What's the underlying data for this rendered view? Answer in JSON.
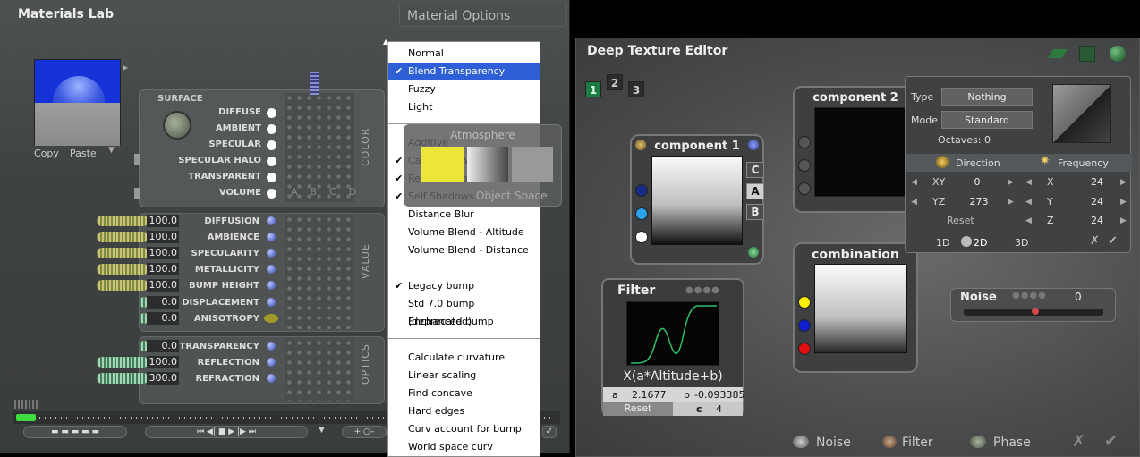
{
  "materials_lab": {
    "title": "Materials Lab",
    "material_options_label": "Material Options",
    "copy_label": "Copy",
    "paste_label": "Paste",
    "surface": {
      "label": "SURFACE",
      "side_label": "COLOR",
      "rows": [
        "DIFFUSE",
        "AMBIENT",
        "SPECULAR",
        "SPECULAR HALO",
        "TRANSPARENT",
        "VOLUME"
      ],
      "abcd": [
        "A",
        "B",
        "C",
        "D"
      ]
    },
    "value": {
      "side_label": "VALUE",
      "rows": [
        {
          "label": "DIFFUSION",
          "value": "100.0"
        },
        {
          "label": "AMBIENCE",
          "value": "100.0"
        },
        {
          "label": "SPECULARITY",
          "value": "100.0"
        },
        {
          "label": "METALLICITY",
          "value": "100.0"
        },
        {
          "label": "BUMP HEIGHT",
          "value": "100.0"
        },
        {
          "label": "DISPLACEMENT",
          "value": "0.0"
        },
        {
          "label": "ANISOTROPY",
          "value": "0.0"
        }
      ]
    },
    "optics": {
      "side_label": "OPTICS",
      "rows": [
        {
          "label": "TRANSPARENCY",
          "value": "0.0"
        },
        {
          "label": "REFLECTION",
          "value": "100.0"
        },
        {
          "label": "REFRACTION",
          "value": "300.0"
        }
      ]
    }
  },
  "menu": {
    "group1": [
      {
        "label": "Normal",
        "checked": false,
        "selected": false
      },
      {
        "label": "Blend Transparency",
        "checked": true,
        "selected": true
      },
      {
        "label": "Fuzzy",
        "checked": false,
        "selected": false
      },
      {
        "label": "Light",
        "checked": false,
        "selected": false
      }
    ],
    "group2": [
      {
        "label": "Additive",
        "checked": false
      },
      {
        "label": "Cast Shadows",
        "checked": true
      },
      {
        "label": "Receive Shadows",
        "checked": true
      },
      {
        "label": "Self Shadows",
        "checked": true
      },
      {
        "label": "Distance Blur",
        "checked": false
      },
      {
        "label": "Volume Blend - Altitude",
        "checked": false
      },
      {
        "label": "Volume Blend - Distance",
        "checked": false
      }
    ],
    "group3": [
      {
        "label": "Legacy bump",
        "checked": true
      },
      {
        "label": "Std 7.0 bump (deprecated)",
        "checked": false
      },
      {
        "label": "Enchanced bump",
        "checked": false
      }
    ],
    "group4": [
      {
        "label": "Calculate curvature",
        "checked": false
      },
      {
        "label": "Linear scaling",
        "checked": false
      },
      {
        "label": "Find concave",
        "checked": false
      },
      {
        "label": "Hard edges",
        "checked": false
      },
      {
        "label": "Curv account for bump",
        "checked": false
      },
      {
        "label": "World space curv",
        "checked": false
      }
    ]
  },
  "atmosphere": {
    "title": "Atmosphere",
    "object_space": "Object Space"
  },
  "deep_texture_editor": {
    "title": "Deep Texture Editor",
    "tabs": [
      "1",
      "2",
      "3"
    ],
    "component1": {
      "title": "component 1",
      "layers": [
        "C",
        "A",
        "B"
      ]
    },
    "component2": {
      "title": "component 2"
    },
    "combination": {
      "title": "combination"
    },
    "filter": {
      "title": "Filter",
      "formula": "X(a*Altitude+b)",
      "a_label": "a",
      "a_value": "2.1677",
      "b_label": "b",
      "b_value": "-0.093385",
      "c_label": "c",
      "c_value": "4",
      "reset_label": "Reset"
    },
    "props": {
      "type_label": "Type",
      "type_value": "Nothing",
      "mode_label": "Mode",
      "mode_value": "Standard",
      "octaves": "Octaves: 0",
      "direction_label": "Direction",
      "frequency_label": "Frequency",
      "xy_label": "XY",
      "xy_value": "0",
      "yz_label": "YZ",
      "yz_value": "273",
      "reset_label": "Reset",
      "x_label": "X",
      "x_value": "24",
      "y_label": "Y",
      "y_value": "24",
      "z_label": "Z",
      "z_value": "24",
      "dims": [
        "1D",
        "2D",
        "3D"
      ]
    },
    "noise": {
      "label": "Noise",
      "value": "0"
    },
    "bottom_buttons": {
      "noise": "Noise",
      "filter": "Filter",
      "phase": "Phase"
    },
    "colors": {
      "accent_green": "#1d7a40",
      "yellow": "#ffee00",
      "blue": "#1020d0",
      "red": "#e01010"
    }
  }
}
